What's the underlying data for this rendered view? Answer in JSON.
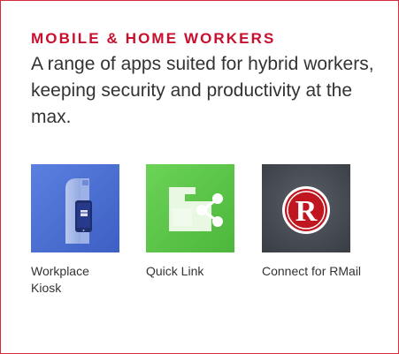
{
  "section": {
    "heading": "MOBILE & HOME WORKERS",
    "description": "A range of apps suited for hybrid workers, keeping security and productivity at the max."
  },
  "apps": [
    {
      "label": "Workplace Kiosk",
      "icon": "kiosk-phone-icon",
      "tile_color": "#4a6fd3"
    },
    {
      "label": "Quick Link",
      "icon": "share-link-icon",
      "tile_color": "#5ec64a"
    },
    {
      "label": "Connect for RMail",
      "icon": "rmail-logo-icon",
      "tile_color": "#4b5058"
    }
  ],
  "colors": {
    "accent": "#c8102e",
    "border": "#d62b3a",
    "text": "#333333"
  }
}
